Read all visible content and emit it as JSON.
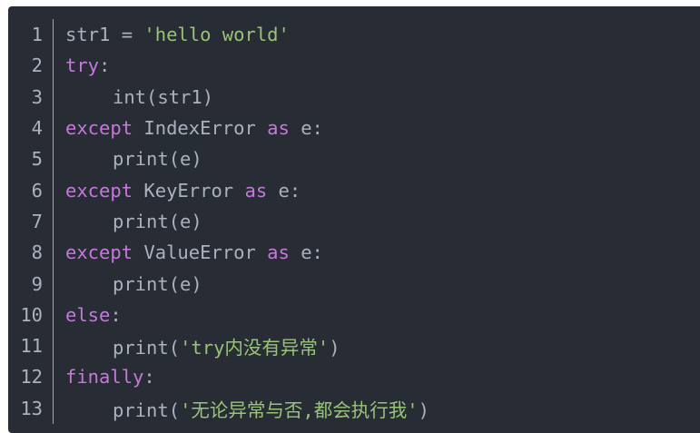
{
  "colors": {
    "background": "#282c34",
    "text": "#abb2bf",
    "keyword": "#c678dd",
    "string": "#98c379"
  },
  "lines": [
    {
      "num": "1",
      "indent": false,
      "tokens": [
        {
          "type": "plain",
          "text": "str1 = "
        },
        {
          "type": "str",
          "text": "'hello world'"
        }
      ]
    },
    {
      "num": "2",
      "indent": false,
      "tokens": [
        {
          "type": "kw",
          "text": "try"
        },
        {
          "type": "plain",
          "text": ":"
        }
      ]
    },
    {
      "num": "3",
      "indent": true,
      "tokens": [
        {
          "type": "plain",
          "text": "int(str1)"
        }
      ]
    },
    {
      "num": "4",
      "indent": false,
      "tokens": [
        {
          "type": "kw",
          "text": "except"
        },
        {
          "type": "plain",
          "text": " IndexError "
        },
        {
          "type": "kw",
          "text": "as"
        },
        {
          "type": "plain",
          "text": " e:"
        }
      ]
    },
    {
      "num": "5",
      "indent": true,
      "tokens": [
        {
          "type": "plain",
          "text": "print(e)"
        }
      ]
    },
    {
      "num": "6",
      "indent": false,
      "tokens": [
        {
          "type": "kw",
          "text": "except"
        },
        {
          "type": "plain",
          "text": " KeyError "
        },
        {
          "type": "kw",
          "text": "as"
        },
        {
          "type": "plain",
          "text": " e:"
        }
      ]
    },
    {
      "num": "7",
      "indent": true,
      "tokens": [
        {
          "type": "plain",
          "text": "print(e)"
        }
      ]
    },
    {
      "num": "8",
      "indent": false,
      "tokens": [
        {
          "type": "kw",
          "text": "except"
        },
        {
          "type": "plain",
          "text": " ValueError "
        },
        {
          "type": "kw",
          "text": "as"
        },
        {
          "type": "plain",
          "text": " e:"
        }
      ]
    },
    {
      "num": "9",
      "indent": true,
      "tokens": [
        {
          "type": "plain",
          "text": "print(e)"
        }
      ]
    },
    {
      "num": "10",
      "indent": false,
      "tokens": [
        {
          "type": "kw",
          "text": "else"
        },
        {
          "type": "plain",
          "text": ":"
        }
      ]
    },
    {
      "num": "11",
      "indent": true,
      "tokens": [
        {
          "type": "plain",
          "text": "print("
        },
        {
          "type": "str",
          "text": "'try内没有异常'"
        },
        {
          "type": "plain",
          "text": ")"
        }
      ]
    },
    {
      "num": "12",
      "indent": false,
      "tokens": [
        {
          "type": "kw",
          "text": "finally"
        },
        {
          "type": "plain",
          "text": ":"
        }
      ]
    },
    {
      "num": "13",
      "indent": true,
      "tokens": [
        {
          "type": "plain",
          "text": "print("
        },
        {
          "type": "str",
          "text": "'无论异常与否,都会执行我'"
        },
        {
          "type": "plain",
          "text": ")"
        }
      ]
    }
  ]
}
